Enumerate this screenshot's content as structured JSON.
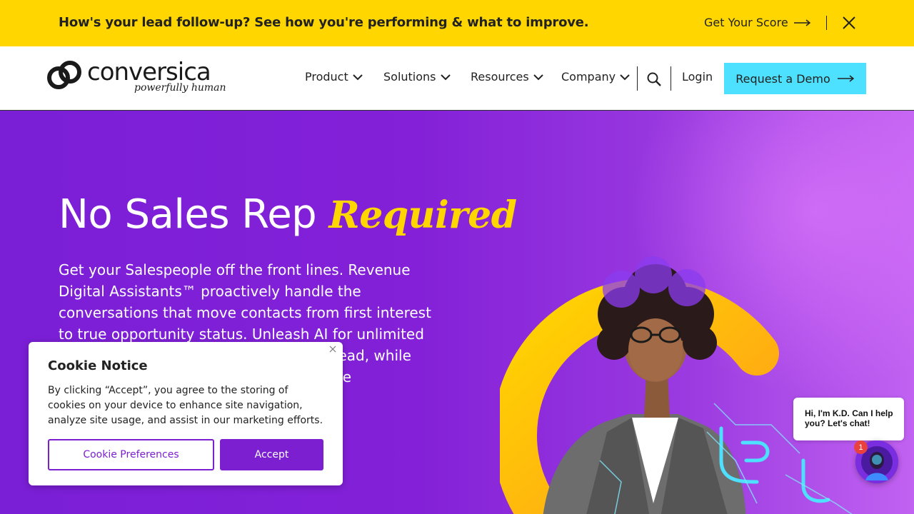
{
  "announcement": {
    "text": "How's your lead follow-up? See how you're performing & what to improve.",
    "cta_label": "Get Your Score"
  },
  "header": {
    "logo_word": "conversica",
    "logo_tagline": "powerfully human",
    "nav": [
      {
        "label": "Product"
      },
      {
        "label": "Solutions"
      },
      {
        "label": "Resources"
      },
      {
        "label": "Company"
      }
    ],
    "login_label": "Login",
    "demo_label": "Request a Demo"
  },
  "hero": {
    "title_plain": "No Sales Rep",
    "title_accent": "Required",
    "copy": "Get your Salespeople off the front lines. Revenue Digital Assistants™ proactively handle the conversations that move contacts from first interest to true opportunity status. Unleash AI for unlimited capacity to engage and nurture every lead, while your team focuses on your highest-value opportunities."
  },
  "cookie": {
    "title": "Cookie Notice",
    "body": "By clicking “Accept”, you agree to the storing of cookies on your device to enhance site navigation, analyze site usage, and assist in our marketing efforts.",
    "preferences_label": "Cookie Preferences",
    "accept_label": "Accept"
  },
  "chat": {
    "message": "Hi, I'm K.D. Can I help you? Let's chat!",
    "badge_count": "1"
  },
  "colors": {
    "banner": "#ffd600",
    "primary_purple": "#7b1fd0",
    "cta_cyan": "#4de1ff",
    "accent_yellow": "#ffd600"
  },
  "icons": [
    "arrow-right-icon",
    "close-icon",
    "chevron-down-icon",
    "search-icon",
    "chat-avatar-icon"
  ]
}
